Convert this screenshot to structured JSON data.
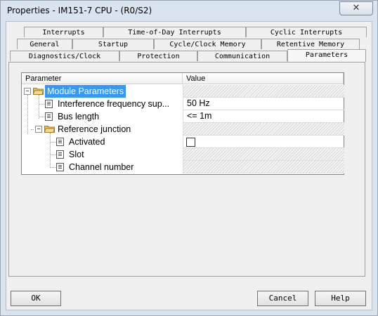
{
  "window": {
    "title": "Properties - IM151-7 CPU - (R0/S2)",
    "close_glyph": "✕"
  },
  "tabs": {
    "row1": [
      "Interrupts",
      "Time-of-Day Interrupts",
      "Cyclic Interrupts"
    ],
    "row2": [
      "General",
      "Startup",
      "Cycle/Clock Memory",
      "Retentive Memory"
    ],
    "row3": [
      "Diagnostics/Clock",
      "Protection",
      "Communication",
      "Parameters"
    ],
    "active": "Parameters"
  },
  "table": {
    "headers": {
      "parameter": "Parameter",
      "value": "Value"
    },
    "rows": [
      {
        "label": "Module Parameters",
        "value": "",
        "kind": "folder"
      },
      {
        "label": "Interference frequency sup...",
        "value": "50 Hz",
        "kind": "leaf"
      },
      {
        "label": "Bus length",
        "value": "<= 1m",
        "kind": "leaf"
      },
      {
        "label": "Reference junction",
        "value": "",
        "kind": "folder"
      },
      {
        "label": "Activated",
        "value": "",
        "kind": "checkbox"
      },
      {
        "label": "Slot",
        "value": "",
        "kind": "leaf"
      },
      {
        "label": "Channel number",
        "value": "",
        "kind": "leaf"
      }
    ]
  },
  "buttons": {
    "ok": "OK",
    "cancel": "Cancel",
    "help": "Help"
  },
  "colors": {
    "selection": "#3399ff",
    "titlebar": "#d9e4f1",
    "dialog_bg": "#f0f0f0",
    "folder": "#e9c25b"
  }
}
